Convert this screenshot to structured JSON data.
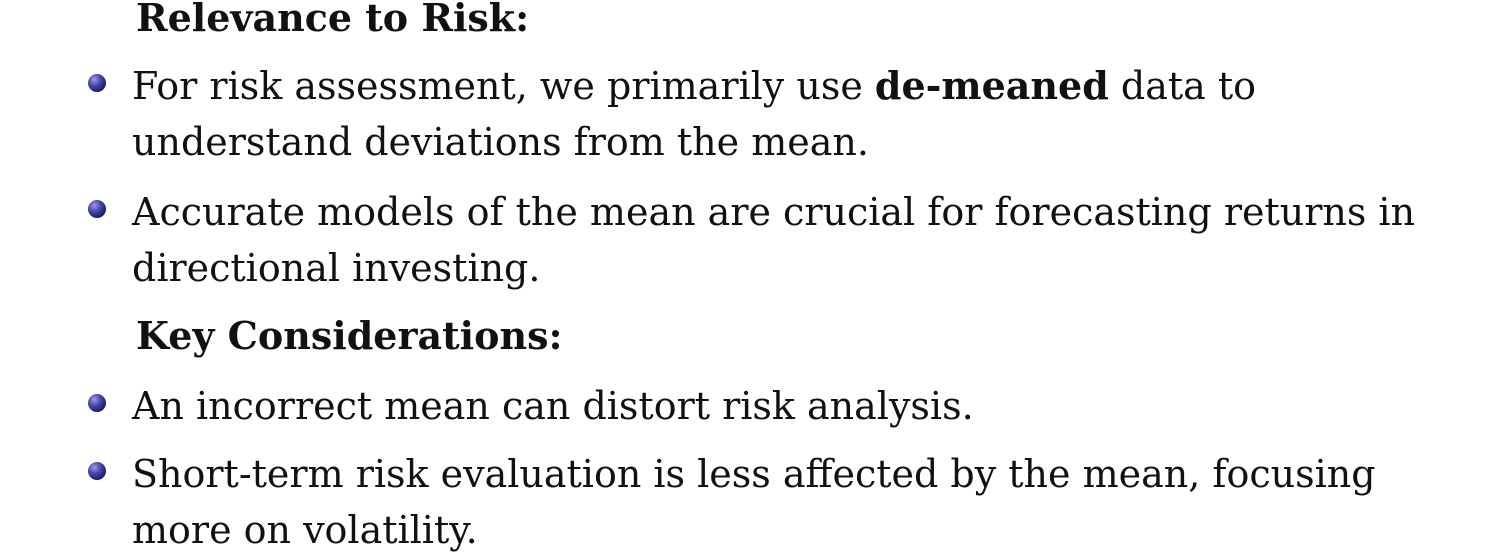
{
  "sections": [
    {
      "heading": "Relevance to Risk:",
      "bullets": [
        {
          "line1_pre": "For risk assessment, we primarily use ",
          "line1_bold": "de-meaned",
          "line1_post": " data to",
          "line2": "understand deviations from the mean."
        },
        {
          "line1": "Accurate models of the mean are crucial for forecasting returns in",
          "line2": "directional investing."
        }
      ]
    },
    {
      "heading": "Key Considerations:",
      "bullets": [
        {
          "line1": "An incorrect mean can distort risk analysis."
        },
        {
          "line1": "Short-term risk evaluation is less affected by the mean, focusing",
          "line2": "more on volatility."
        }
      ]
    }
  ]
}
